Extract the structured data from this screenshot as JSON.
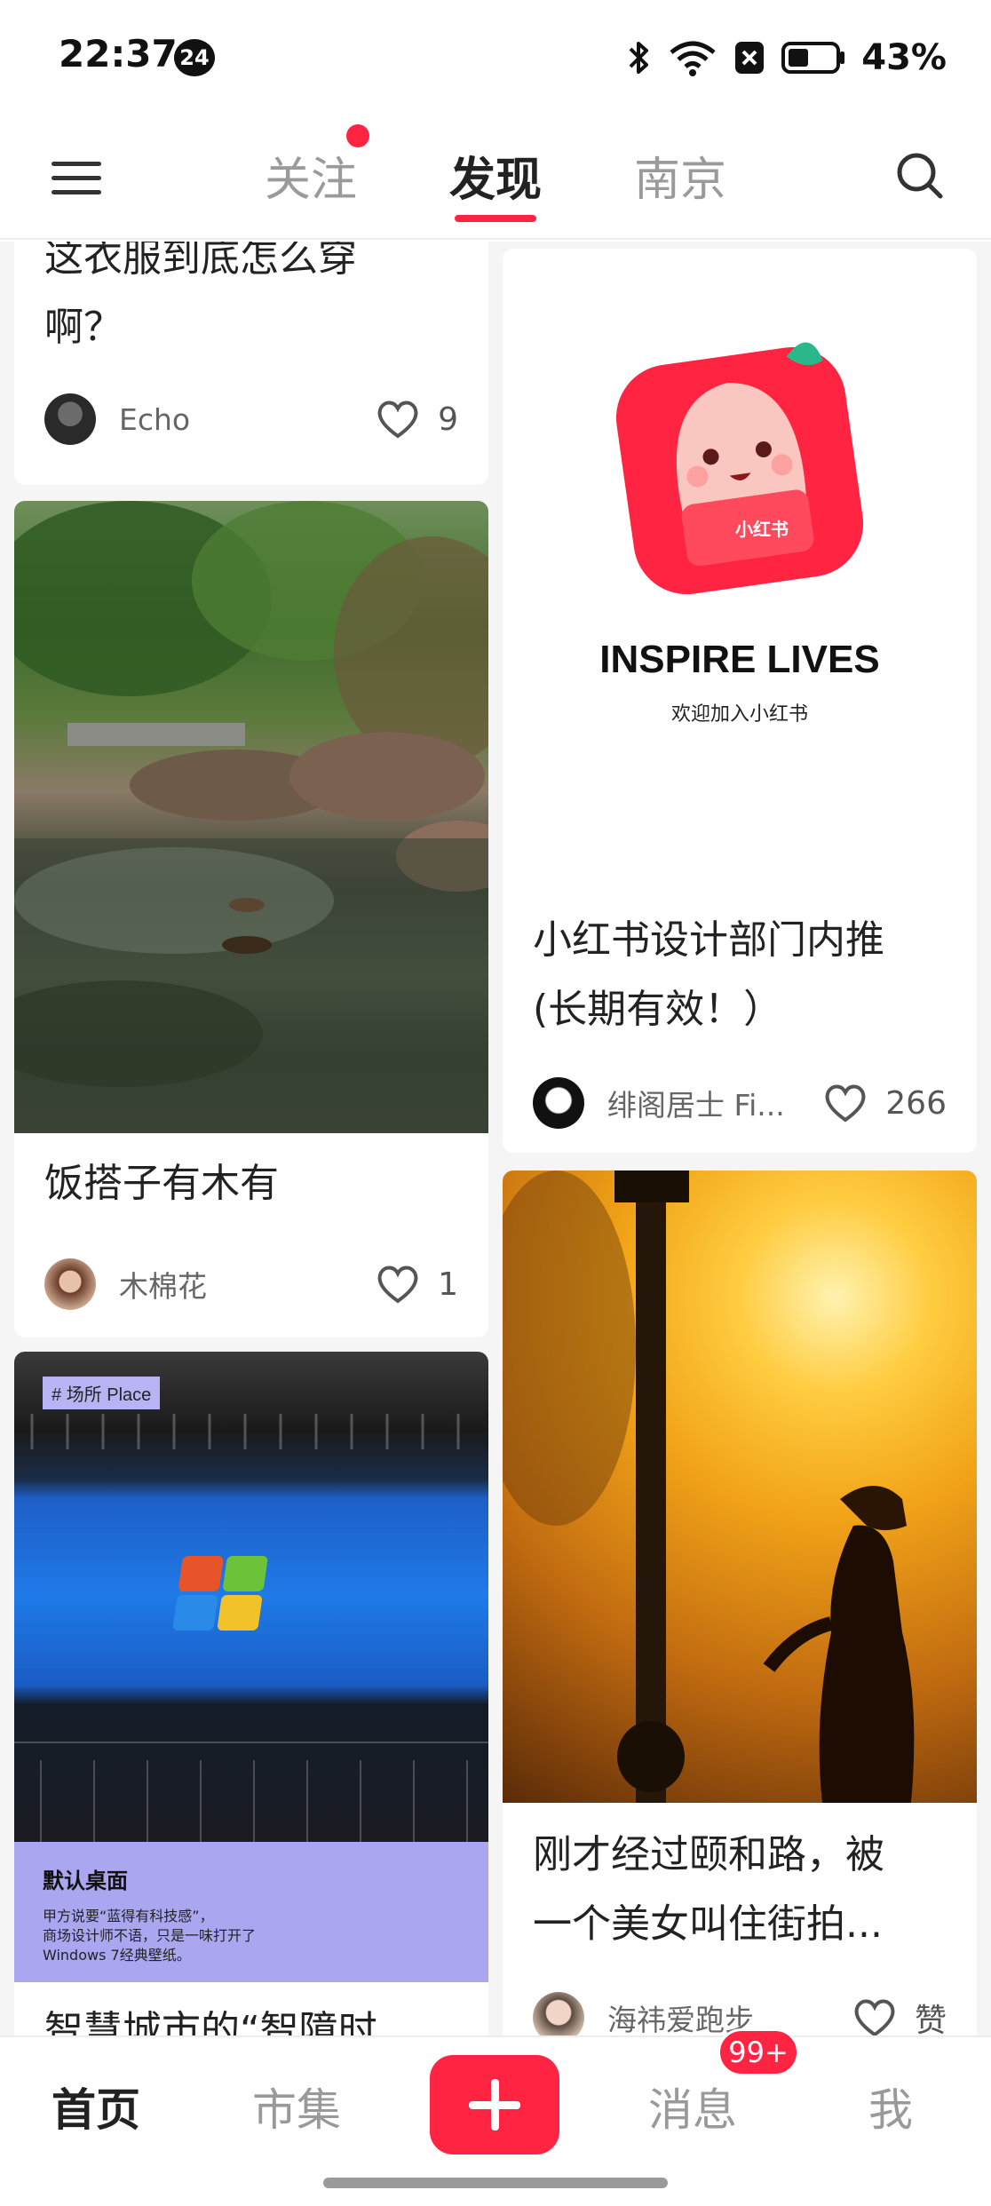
{
  "status_bar": {
    "time": "22:37",
    "notification_count": "24",
    "battery_percent": "43%",
    "icons": [
      "bluetooth-icon",
      "wifi-icon",
      "app-notification-icon",
      "battery-icon"
    ]
  },
  "header": {
    "tabs": [
      {
        "label": "关注",
        "has_dot": true
      },
      {
        "label": "发现",
        "active": true
      },
      {
        "label": "南京"
      }
    ]
  },
  "feed": {
    "cards": [
      {
        "title_line1": "这衣服到底怎么穿",
        "title_line2": "啊？",
        "author": "Echo",
        "likes": "9"
      },
      {
        "title": "饭搭子有木有",
        "author": "木棉花",
        "likes": "1"
      },
      {
        "tag": "# 场所 Place",
        "caption_title": "默认桌面",
        "caption_body_1": "甲方说要“蓝得有科技感”，",
        "caption_body_2": "商场设计师不语，只是一味打开了",
        "caption_body_3": "Windows 7经典壁纸。",
        "title": "智慧城市的“智障时"
      },
      {
        "logo_text": "小红书",
        "banner_heading": "INSPIRE LIVES",
        "banner_sub": "欢迎加入小红书",
        "title_line1": "小红书设计部门内推",
        "title_line2": "(长期有效！）",
        "author": "绯阁居士 Fi...",
        "likes": "266"
      },
      {
        "title_line1": "刚才经过颐和路，被",
        "title_line2": "一个美女叫住街拍...",
        "author": "海祎爱跑步",
        "likes": "赞"
      }
    ]
  },
  "bottom_nav": {
    "items": [
      "首页",
      "市集",
      "消息",
      "我"
    ],
    "message_badge": "99+"
  },
  "colors": {
    "accent": "#ff2442",
    "text": "#222222",
    "muted": "#999999"
  }
}
